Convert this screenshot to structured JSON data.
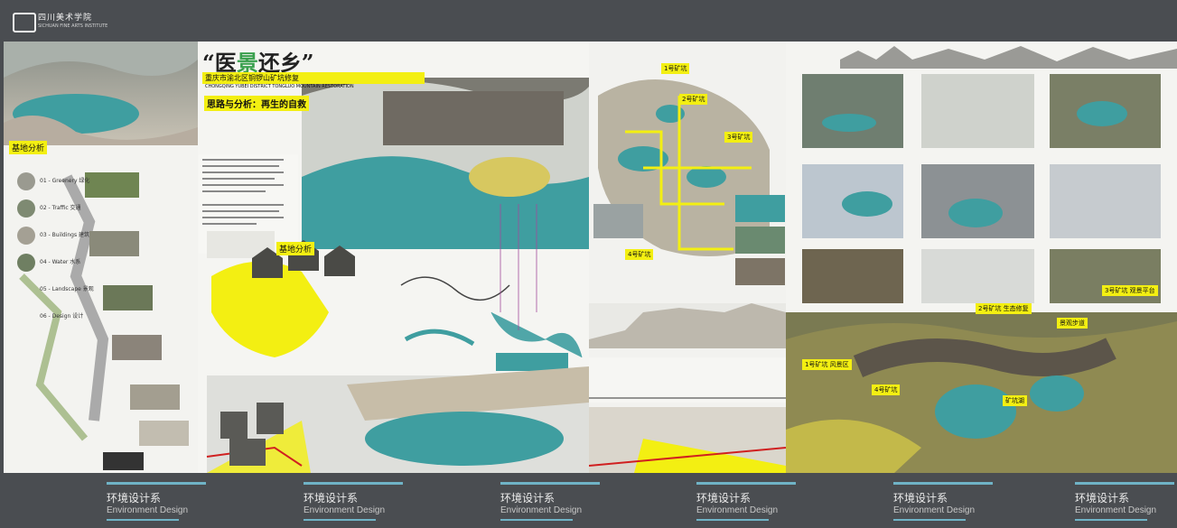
{
  "header": {
    "logo_cn": "四川美术学院",
    "logo_en": "SICHUAN FINE ARTS INSTITUTE"
  },
  "board1": {
    "title_pre": "“医",
    "title_hl": "景",
    "title_post": "还乡”",
    "subtitle": "重庆市渝北区铜锣山矿坑修复",
    "subtitle_en": "CHONGQING YUBEI DISTRICT TONGLUO MOUNTAIN RESTORATION",
    "section_thinking": "思路与分析：",
    "section_thinking_sub": "再生的自救",
    "section_base": "基地分析",
    "section_base2": "基地分析",
    "list_items": [
      "01 - Greenery 绿化",
      "02 - Traffic 交通",
      "03 - Buildings 建筑",
      "04 - Water 水系",
      "05 - Landscape 景观",
      "06 - Design 设计"
    ]
  },
  "board2": {
    "labels": [
      "1号矿坑",
      "2号矿坑",
      "3号矿坑",
      "4号矿坑"
    ]
  },
  "board3": {
    "labels": [
      "1号矿坑 风景区",
      "2号矿坑 生态修复",
      "景观步道",
      "3号矿坑 观景平台",
      "4号矿坑",
      "矿坑湖"
    ]
  },
  "footer": {
    "items": [
      {
        "cn": "环境设计系",
        "en": "Environment Design"
      },
      {
        "cn": "环境设计系",
        "en": "Environment Design"
      },
      {
        "cn": "环境设计系",
        "en": "Environment Design"
      },
      {
        "cn": "环境设计系",
        "en": "Environment Design"
      },
      {
        "cn": "环境设计系",
        "en": "Environment Design"
      },
      {
        "cn": "环境设计系",
        "en": "Environment Design"
      }
    ]
  },
  "colors": {
    "accent_yellow": "#f3ef12",
    "water": "#3f9ea0",
    "teal_line": "#6fb3c6",
    "frame": "#4a4d51"
  }
}
